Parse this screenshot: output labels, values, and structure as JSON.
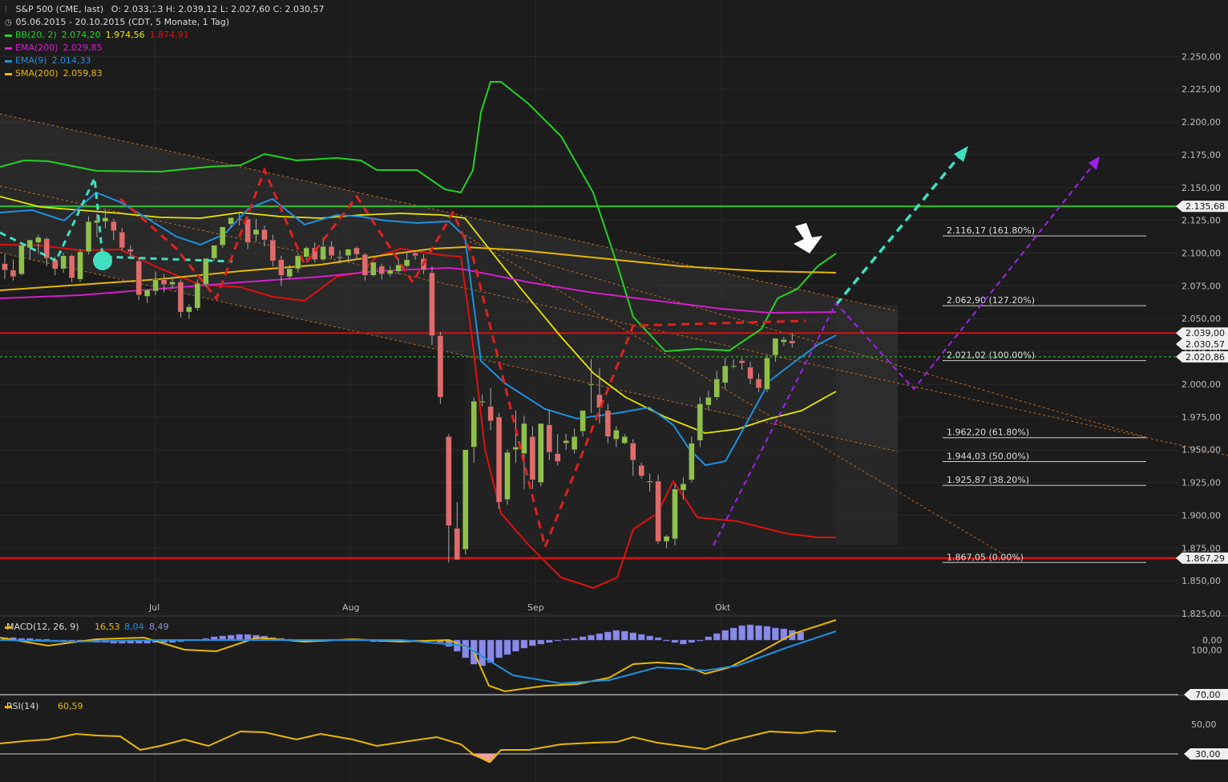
{
  "header": {
    "title": "S&P 500 (CME, last)",
    "ohlc": "O: 2.033,13  H: 2.039,12  L: 2.027,60  C: 2.030,57",
    "period": "05.06.2015 - 20.10.2015 (CDT, 5 Monate, 1 Tag)"
  },
  "legend": [
    {
      "label": "BB(20, 2)",
      "values": [
        "2.074,20",
        "1.974,56",
        "1.874,91"
      ],
      "colors": [
        "#22d322",
        "#e6e600",
        "#e01010"
      ]
    },
    {
      "label": "EMA(200)",
      "values": [
        "2.029,85"
      ],
      "colors": [
        "#d21fc8"
      ]
    },
    {
      "label": "EMA(9)",
      "values": [
        "2.014,33"
      ],
      "colors": [
        "#1e90e0"
      ]
    },
    {
      "label": "SMA(200)",
      "values": [
        "2.059,83"
      ],
      "colors": [
        "#e8b800"
      ]
    }
  ],
  "colors": {
    "background": "#1c1c1c",
    "grid": "#2a2a2a",
    "up": "#8fc14a",
    "down": "#e06b6b",
    "bb_upper": "#22d322",
    "bb_mid": "#e6e600",
    "bb_lower": "#e01010",
    "ema200": "#d21fc8",
    "ema9": "#1e90e0",
    "sma200": "#e8b800",
    "macd_hist": "#8a8ae8",
    "rsi": "#e8b800"
  },
  "chart_data": [
    {
      "type": "line",
      "title": "S&P 500 (CME, last)",
      "x_tick_labels": [
        "Jul",
        "Aug",
        "Sep",
        "Okt"
      ],
      "y_ticks": [
        1825,
        1850,
        1875,
        1900,
        1925,
        1950,
        1975,
        2000,
        2025,
        2050,
        2075,
        2100,
        2125,
        2150,
        2175,
        2200,
        2225,
        2250
      ],
      "ylim": [
        1825,
        2260
      ],
      "price_labels": [
        {
          "value": 2135.68,
          "label": "2.135,68"
        },
        {
          "value": 2039.0,
          "label": "2.039,00"
        },
        {
          "value": 2030.57,
          "label": "2.030,57"
        },
        {
          "value": 2020.86,
          "label": "2.020,86"
        },
        {
          "value": 1867.29,
          "label": "1.867,29"
        }
      ],
      "fibonacci": [
        {
          "value": 2116.17,
          "label": "2.116,17 (161.80%)"
        },
        {
          "value": 2062.9,
          "label": "2.062,90 (127.20%)"
        },
        {
          "value": 2021.02,
          "label": "2.021,02 (100.00%)"
        },
        {
          "value": 1962.2,
          "label": "1.962,20 (61.80%)"
        },
        {
          "value": 1944.03,
          "label": "1.944,03 (50.00%)"
        },
        {
          "value": 1925.87,
          "label": "1.925,87 (38.20%)"
        },
        {
          "value": 1867.05,
          "label": "1.867,05 (0.00%)"
        }
      ],
      "candles": [
        [
          2092,
          2099,
          2087,
          2080
        ],
        [
          2087,
          2095,
          2082,
          2079
        ],
        [
          2084,
          2103,
          2106,
          2083
        ],
        [
          2104,
          2110,
          2110,
          2095
        ],
        [
          2108,
          2114,
          2112,
          2100
        ],
        [
          2111,
          2112,
          2096,
          2090
        ],
        [
          2095,
          2097,
          2088,
          2083
        ],
        [
          2088,
          2100,
          2098,
          2085
        ],
        [
          2098,
          2099,
          2081,
          2078
        ],
        [
          2080,
          2103,
          2101,
          2078
        ],
        [
          2101,
          2128,
          2124,
          2099
        ],
        [
          2123,
          2130,
          2125,
          2112
        ],
        [
          2124,
          2133,
          2127,
          2119
        ],
        [
          2124,
          2126,
          2117,
          2110
        ],
        [
          2116,
          2119,
          2104,
          2102
        ],
        [
          2103,
          2106,
          2101,
          2096
        ],
        [
          2094,
          2096,
          2068,
          2064
        ],
        [
          2067,
          2071,
          2072,
          2062
        ],
        [
          2071,
          2086,
          2080,
          2068
        ],
        [
          2080,
          2084,
          2076,
          2070
        ],
        [
          2076,
          2081,
          2078,
          2073
        ],
        [
          2078,
          2080,
          2055,
          2051
        ],
        [
          2055,
          2061,
          2059,
          2050
        ],
        [
          2058,
          2080,
          2077,
          2056
        ],
        [
          2076,
          2096,
          2096,
          2074
        ],
        [
          2096,
          2104,
          2106,
          2094
        ],
        [
          2106,
          2120,
          2120,
          2104
        ],
        [
          2122,
          2126,
          2127,
          2119
        ],
        [
          2126,
          2131,
          2125,
          2121
        ],
        [
          2126,
          2128,
          2108,
          2103
        ],
        [
          2114,
          2126,
          2118,
          2109
        ],
        [
          2118,
          2121,
          2110,
          2105
        ],
        [
          2110,
          2114,
          2094,
          2090
        ],
        [
          2095,
          2098,
          2083,
          2075
        ],
        [
          2082,
          2091,
          2088,
          2080
        ],
        [
          2088,
          2100,
          2098,
          2085
        ],
        [
          2097,
          2105,
          2104,
          2095
        ],
        [
          2104,
          2108,
          2095,
          2093
        ],
        [
          2095,
          2112,
          2105,
          2094
        ],
        [
          2105,
          2109,
          2098,
          2096
        ],
        [
          2097,
          2102,
          2097,
          2092
        ],
        [
          2098,
          2101,
          2103,
          2093
        ],
        [
          2104,
          2105,
          2099,
          2095
        ],
        [
          2099,
          2100,
          2083,
          2079
        ],
        [
          2083,
          2088,
          2093,
          2082
        ],
        [
          2090,
          2092,
          2084,
          2080
        ],
        [
          2084,
          2090,
          2087,
          2082
        ],
        [
          2086,
          2096,
          2091,
          2084
        ],
        [
          2090,
          2101,
          2095,
          2089
        ],
        [
          2100,
          2102,
          2098,
          2095
        ],
        [
          2096,
          2099,
          2087,
          2084
        ],
        [
          2085,
          2090,
          2037,
          2030
        ],
        [
          2037,
          2040,
          1990,
          1985
        ],
        [
          1960,
          1962,
          1892,
          1864
        ],
        [
          1890,
          1910,
          1866,
          1866
        ],
        [
          1874,
          1950,
          1950,
          1870
        ],
        [
          1952,
          1990,
          1987,
          1940
        ],
        [
          1986,
          1992,
          1987,
          1983
        ],
        [
          1983,
          1997,
          1972,
          1965
        ],
        [
          1975,
          1978,
          1910,
          1905
        ],
        [
          1912,
          1950,
          1948,
          1908
        ],
        [
          1950,
          1980,
          1952,
          1940
        ],
        [
          1947,
          1976,
          1970,
          1920
        ],
        [
          1960,
          1968,
          1927,
          1920
        ],
        [
          1925,
          1970,
          1970,
          1922
        ],
        [
          1969,
          1980,
          1948,
          1942
        ],
        [
          1947,
          1962,
          1941,
          1938
        ],
        [
          1955,
          1962,
          1957,
          1950
        ],
        [
          1950,
          1966,
          1960,
          1947
        ],
        [
          1964,
          1980,
          1980,
          1960
        ],
        [
          2000,
          2019,
          2000,
          1978
        ],
        [
          1992,
          2012,
          1982,
          1970
        ],
        [
          1980,
          1985,
          1960,
          1955
        ],
        [
          1958,
          1968,
          1965,
          1952
        ],
        [
          1955,
          1962,
          1960,
          1954
        ],
        [
          1955,
          1958,
          1942,
          1930
        ],
        [
          1938,
          1940,
          1930,
          1928
        ],
        [
          1926,
          1932,
          1926,
          1918
        ],
        [
          1926,
          1931,
          1880,
          1878
        ],
        [
          1880,
          1885,
          1884,
          1875
        ],
        [
          1882,
          1924,
          1920,
          1877
        ],
        [
          1919,
          1929,
          1924,
          1912
        ],
        [
          1927,
          1960,
          1955,
          1925
        ],
        [
          1957,
          1990,
          1985,
          1952
        ],
        [
          1984,
          1995,
          1990,
          1980
        ],
        [
          1990,
          2010,
          2004,
          1988
        ],
        [
          2001,
          2020,
          2014,
          1996
        ],
        [
          2014,
          2019,
          2014,
          2012
        ],
        [
          2018,
          2020,
          2016,
          2011
        ],
        [
          2013,
          2017,
          2004,
          2000
        ],
        [
          2004,
          2008,
          1997,
          1994
        ],
        [
          1996,
          2022,
          2020,
          1994
        ],
        [
          2022,
          2034,
          2035,
          2017
        ],
        [
          2032,
          2036,
          2034,
          2029
        ],
        [
          2033,
          2039,
          2031,
          2028
        ]
      ]
    },
    {
      "type": "bar",
      "title": "MACD(12, 26, 9)",
      "series": [
        {
          "name": "MACD(12, 26, 9)",
          "last": 16.53
        },
        {
          "name": "signal",
          "last": 8.04
        },
        {
          "name": "histogram",
          "last": 8.49
        }
      ],
      "y_ticks": [
        0
      ],
      "y_tick_labels": [
        "0,00"
      ]
    },
    {
      "type": "line",
      "title": "RSI(14)",
      "series": [
        {
          "name": "RSI(14)",
          "last": 60.59
        }
      ],
      "y_ticks": [
        100,
        70,
        50,
        30
      ],
      "y_tick_labels": [
        "100,00",
        "70,00",
        "50,00",
        "30,00"
      ],
      "ylim": [
        0,
        100
      ]
    }
  ],
  "texts": {
    "legend_values_fmt": "values separated by two spaces",
    "macd_vals": [
      "16,53",
      "8,04",
      "8,49"
    ],
    "rsi_val": "60,59"
  }
}
